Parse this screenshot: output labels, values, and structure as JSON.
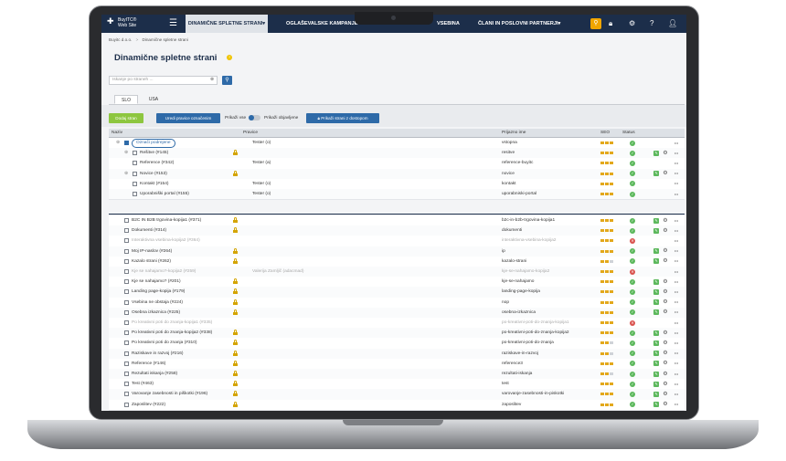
{
  "logo": {
    "text": "BuyITC® Web Site"
  },
  "nav": {
    "menu_icon": "hamburger-icon",
    "tabs": [
      {
        "label": "DINAMIČNE SPLETNE STRANI▾",
        "active": true
      },
      {
        "label": "OGLAŠEVALSKE KAMPANJE",
        "active": false
      },
      {
        "label": "VSEBINA",
        "active": false
      },
      {
        "label": "ČLANI IN POSLOVNI PARTNERJI▾",
        "active": false
      }
    ],
    "icons": [
      "search-icon",
      "lock-icon",
      "gear-icon",
      "help-icon",
      "user-icon"
    ]
  },
  "breadcrumb": {
    "root": "Buyitc d.o.o.",
    "sep": ">",
    "current": "Dinamične spletne strani"
  },
  "page_title": "Dinamične spletne strani",
  "search": {
    "placeholder": "Iskanje po straneh ..."
  },
  "lang_tabs": [
    "SLO",
    "USA"
  ],
  "toolbar": {
    "add": "Dodaj stran",
    "edit_rights": "Uredi pravice označenim",
    "show_all": "Prikaži vse",
    "show_published": "Prikaži objavljene",
    "show_access": "Prikaži strani z dostopom"
  },
  "columns": [
    "Naziv",
    "Pravice",
    "Prijazno ime",
    "SEO",
    "Status"
  ],
  "tree_rows": [
    {
      "name": "Označi podrejene",
      "rights": "Tester (o)",
      "slug": "vstopna",
      "seo": 3,
      "status": "ok",
      "highlight": true,
      "checked": true,
      "lock": false,
      "actions": false
    },
    {
      "name": "Rešitve (#145)",
      "rights": "",
      "slug": "resitve",
      "seo": 3,
      "status": "ok",
      "lock": true,
      "actions": true
    },
    {
      "name": "Reference (#342)",
      "rights": "Tester (a)",
      "slug": "reference-buyitc",
      "seo": 3,
      "status": "ok",
      "lock": false,
      "actions": false
    },
    {
      "name": "Novice (#153)",
      "rights": "",
      "slug": "novice",
      "seo": 3,
      "status": "ok",
      "lock": true,
      "actions": true
    },
    {
      "name": "Kontakt (#154)",
      "rights": "Tester (o)",
      "slug": "kontakt",
      "seo": 3,
      "status": "ok",
      "lock": false,
      "actions": false
    },
    {
      "name": "Uporabniški portal (#155)",
      "rights": "Tester (o)",
      "slug": "uporabniski-portal",
      "seo": 3,
      "status": "ok",
      "lock": false,
      "actions": false
    }
  ],
  "rows": [
    {
      "name": "B2C IN B2B trgovina-kopija1 (#371)",
      "rights": "",
      "slug": "b2c-in-b2b-trgovina-kopija1",
      "seo": 3,
      "status": "ok",
      "dim": false
    },
    {
      "name": "Dokumenti (#314)",
      "rights": "",
      "slug": "dokumenti",
      "seo": 3,
      "status": "ok",
      "dim": false
    },
    {
      "name": "Interaktivna vsebina-kopija2 (#364)",
      "rights": "",
      "slug": "interaktivna-vsebina-kopija2",
      "seo": 3,
      "status": "bad",
      "dim": true
    },
    {
      "name": "Moj IP-naslov (#264)",
      "rights": "",
      "slug": "ip",
      "seo": 3,
      "status": "ok",
      "dim": false
    },
    {
      "name": "Kazalo strani (#262)",
      "rights": "",
      "slug": "kazalo-strani",
      "seo": 2,
      "status": "ok",
      "dim": false
    },
    {
      "name": "Kje se nahajamo?-kopija2 (#259)",
      "rights": "Valerija Zamljič (adacmad)",
      "slug": "kje-se-nahajamo-kopija2",
      "seo": 3,
      "status": "bad",
      "dim": true
    },
    {
      "name": "Kje se nahajamo? (#201)",
      "rights": "",
      "slug": "kje-se-nahajamo",
      "seo": 3,
      "status": "ok",
      "dim": false
    },
    {
      "name": "Landing page-kopija (#179)",
      "rights": "",
      "slug": "landing-page-kopija",
      "seo": 3,
      "status": "ok",
      "dim": false
    },
    {
      "name": "Vsebina ne obstaja (#224)",
      "rights": "",
      "slug": "nop",
      "seo": 3,
      "status": "ok",
      "dim": false
    },
    {
      "name": "Osebna izkaznica (#225)",
      "rights": "",
      "slug": "osebna-izkaznica",
      "seo": 3,
      "status": "ok",
      "dim": false
    },
    {
      "name": "Po kreativni poti do znanja-kopija1 (#335)",
      "rights": "",
      "slug": "po-kreativni-poti-do-znanja-kopija1",
      "seo": 3,
      "status": "bad",
      "dim": true
    },
    {
      "name": "Po kreativni poti do znanja-kopija2 (#338)",
      "rights": "",
      "slug": "po-kreativni-poti-do-znanja-kopija2",
      "seo": 3,
      "status": "ok",
      "dim": false
    },
    {
      "name": "Po kreativni poti do znanja (#310)",
      "rights": "",
      "slug": "po-kreativni-poti-do-znanja",
      "seo": 2,
      "status": "ok",
      "dim": false
    },
    {
      "name": "Raziskave in razvoj (#216)",
      "rights": "",
      "slug": "raziskave-in-razvoj",
      "seo": 2,
      "status": "ok",
      "dim": false
    },
    {
      "name": "Reference (#146)",
      "rights": "",
      "slug": "reference3",
      "seo": 3,
      "status": "ok",
      "dim": false
    },
    {
      "name": "Rezultati iskanja (#258)",
      "rights": "",
      "slug": "rezultati-iskanja",
      "seo": 2,
      "status": "ok",
      "dim": false
    },
    {
      "name": "Test (#463)",
      "rights": "",
      "slug": "test",
      "seo": 3,
      "status": "ok",
      "dim": false
    },
    {
      "name": "Varovanje zasebnosti in piškotki (#196)",
      "rights": "",
      "slug": "varovanje-zasebnosti-in-piskotki",
      "seo": 3,
      "status": "ok",
      "dim": false
    },
    {
      "name": "Zaposlitev (#222)",
      "rights": "",
      "slug": "zaposlitev",
      "seo": 3,
      "status": "ok",
      "dim": false
    }
  ],
  "colors": {
    "nav": "#1c2e4a",
    "accent": "#2e6aa8",
    "add_button": "#8dc63f",
    "warning": "#f0a500",
    "ok": "#5cb85c",
    "error": "#d9534f"
  }
}
